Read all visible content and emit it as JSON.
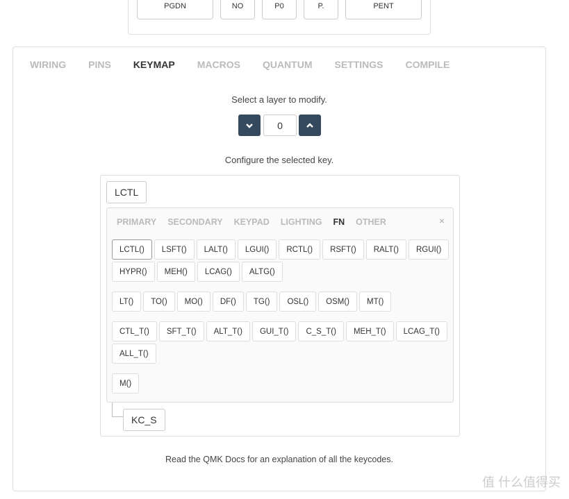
{
  "top_keys": [
    "PGDN",
    "NO",
    "P0",
    "P.",
    "PENT"
  ],
  "tabs": [
    {
      "label": "WIRING"
    },
    {
      "label": "PINS"
    },
    {
      "label": "KEYMAP",
      "active": true
    },
    {
      "label": "MACROS"
    },
    {
      "label": "QUANTUM"
    },
    {
      "label": "SETTINGS"
    },
    {
      "label": "COMPILE"
    }
  ],
  "layer": {
    "prompt": "Select a layer to modify.",
    "value": "0",
    "down_icon": "chevron-down",
    "up_icon": "chevron-up"
  },
  "configure_prompt": "Configure the selected key.",
  "selected_key": "LCTL",
  "picker": {
    "tabs": [
      {
        "label": "PRIMARY"
      },
      {
        "label": "SECONDARY"
      },
      {
        "label": "KEYPAD"
      },
      {
        "label": "LIGHTING"
      },
      {
        "label": "FN",
        "active": true
      },
      {
        "label": "OTHER"
      }
    ],
    "close": "×",
    "groups": [
      [
        "LCTL()",
        "LSFT()",
        "LALT()",
        "LGUI()",
        "RCTL()",
        "RSFT()",
        "RALT()",
        "RGUI()",
        "HYPR()",
        "MEH()",
        "LCAG()",
        "ALTG()"
      ],
      [
        "LT()",
        "TO()",
        "MO()",
        "DF()",
        "TG()",
        "OSL()",
        "OSM()",
        "MT()"
      ],
      [
        "CTL_T()",
        "SFT_T()",
        "ALT_T()",
        "GUI_T()",
        "C_S_T()",
        "MEH_T()",
        "LCAG_T()",
        "ALL_T()"
      ],
      [
        "M()"
      ]
    ]
  },
  "child_key": "KC_S",
  "footer": "Read the QMK Docs for an explanation of all the keycodes.",
  "watermark": "值 什么值得买",
  "colors": {
    "accent": "#34495e"
  }
}
